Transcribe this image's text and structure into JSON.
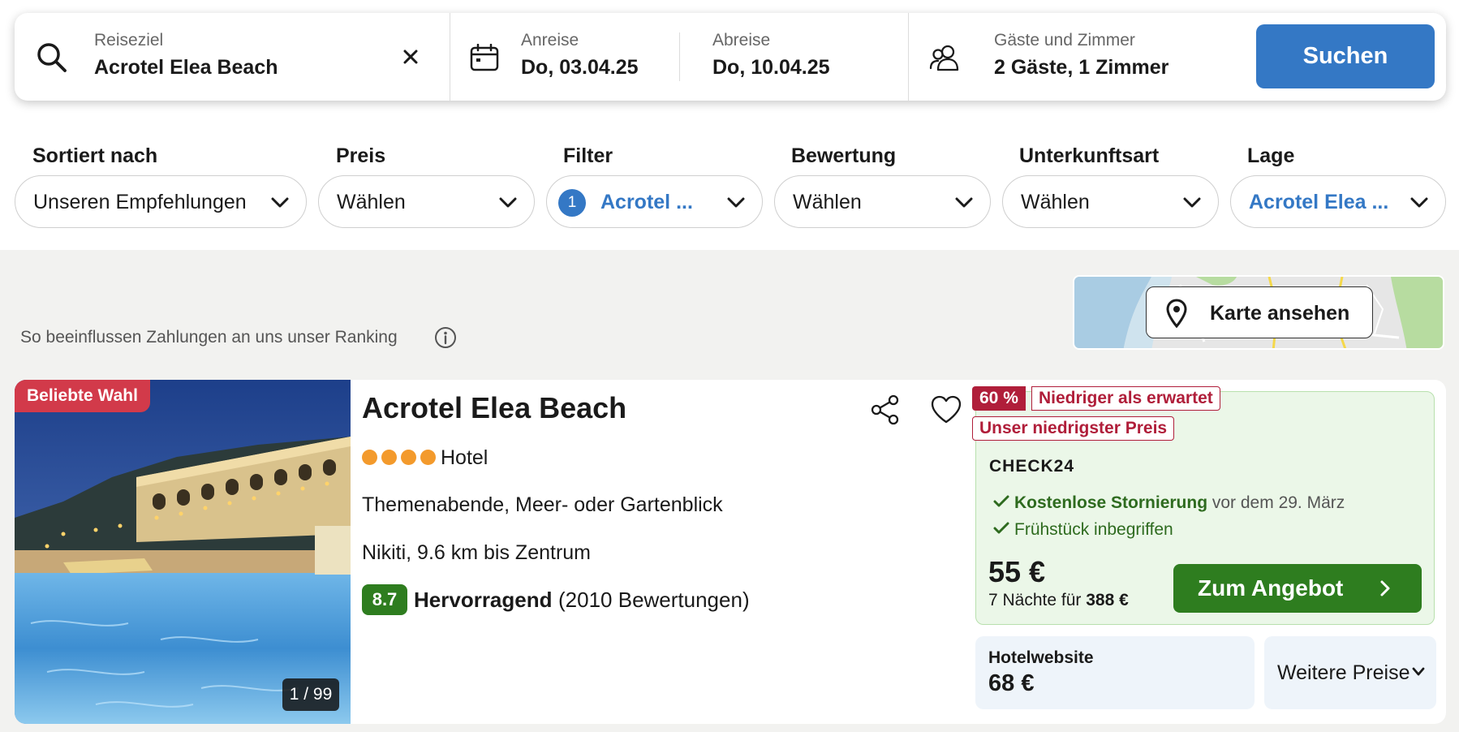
{
  "search": {
    "destination_label": "Reiseziel",
    "destination_value": "Acrotel Elea Beach",
    "checkin_label": "Anreise",
    "checkin_value": "Do, 03.04.25",
    "checkout_label": "Abreise",
    "checkout_value": "Do, 10.04.25",
    "guests_label": "Gäste und Zimmer",
    "guests_value": "2 Gäste, 1 Zimmer",
    "submit_label": "Suchen",
    "icons": [
      "search-icon",
      "close-icon",
      "calendar-icon",
      "guests-icon"
    ]
  },
  "filters": [
    {
      "label": "Sortiert nach",
      "value": "Unseren Empfehlungen",
      "active": false
    },
    {
      "label": "Preis",
      "value": "Wählen",
      "active": false
    },
    {
      "label": "Filter",
      "value": "Acrotel ...",
      "active": true,
      "badge": "1"
    },
    {
      "label": "Bewertung",
      "value": "Wählen",
      "active": false
    },
    {
      "label": "Unterkunftsart",
      "value": "Wählen",
      "active": false
    },
    {
      "label": "Lage",
      "value": "Acrotel Elea ...",
      "active": true
    }
  ],
  "ranking_note": "So beeinflussen Zahlungen an uns unser Ranking",
  "map_button_label": "Karte ansehen",
  "hotel": {
    "badge": "Beliebte Wahl",
    "photo_counter": "1 / 99",
    "name": "Acrotel Elea Beach",
    "stars": 4,
    "type": "Hotel",
    "description": "Themenabende, Meer- oder Gartenblick",
    "location": "Nikiti, 9.6 km bis Zentrum",
    "score": "8.7",
    "rating_word": "Hervorragend",
    "review_count": "(2010 Bewertungen)"
  },
  "offer": {
    "discount_pct": "60 %",
    "discount_text": "Niedriger als erwartet",
    "lowest_price_tag": "Unser niedrigster Preis",
    "provider": "CHECK24",
    "perk1_bold": "Kostenlose Stornierung",
    "perk1_rest": "vor dem 29. März",
    "perk2": "Frühstück inbegriffen",
    "price": "55 €",
    "nights_text": "7 Nächte für",
    "nights_total": "388 €",
    "cta_label": "Zum Angebot"
  },
  "hotel_website": {
    "label": "Hotelwebsite",
    "price": "68 €"
  },
  "more_prices_label": "Weitere Preise",
  "colors": {
    "accent_blue": "#3478c5",
    "green": "#2e7d1f",
    "badge_red": "#d23a4a",
    "discount_red": "#b01e3a",
    "star_orange": "#f39a2c"
  }
}
